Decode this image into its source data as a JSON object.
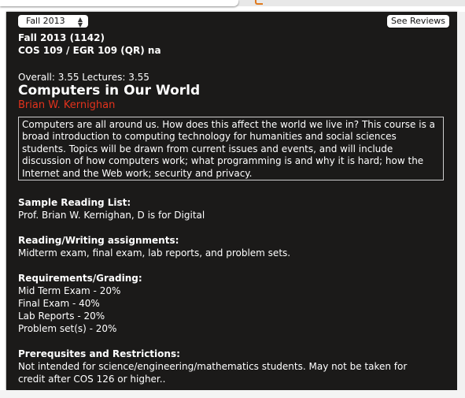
{
  "term_select": {
    "value": "Fall 2013",
    "arrow_icon": "up-down-chevron-icon"
  },
  "reviews_button": {
    "label": "See Reviews"
  },
  "course": {
    "term_code": "Fall 2013 (1142)",
    "listing": "COS 109 / EGR 109 (QR) na",
    "ratings": "Overall: 3.55 Lectures: 3.55",
    "title": "Computers in Our World",
    "instructor": "Brian W. Kernighan",
    "description": "Computers are all around us. How does this affect the world we live in? This course is a broad introduction to computing technology for humanities and social sciences students. Topics will be drawn from current issues and events, and will include discussion of how computers work; what programming is and why it is hard; how the Internet and the Web work; security and privacy."
  },
  "sections": {
    "reading_list": {
      "heading": "Sample Reading List:",
      "lines": [
        "Prof. Brian W. Kernighan, D is for Digital"
      ]
    },
    "assignments": {
      "heading": "Reading/Writing assignments:",
      "lines": [
        "Midterm exam, final exam, lab reports, and problem sets."
      ]
    },
    "grading": {
      "heading": "Requirements/Grading:",
      "lines": [
        "Mid Term Exam - 20%",
        "Final Exam - 40%",
        "Lab Reports - 20%",
        "Problem set(s) - 20%"
      ]
    },
    "prerequisites": {
      "heading": "Prerequsites and Restrictions:",
      "lines": [
        "Not intended for science/engineering/mathematics students. May not be taken for",
        "credit after COS 126 or higher.."
      ]
    }
  },
  "colors": {
    "panel_background": "#1b1a19",
    "instructor_red": "#e4321c",
    "text": "#ffffff"
  }
}
